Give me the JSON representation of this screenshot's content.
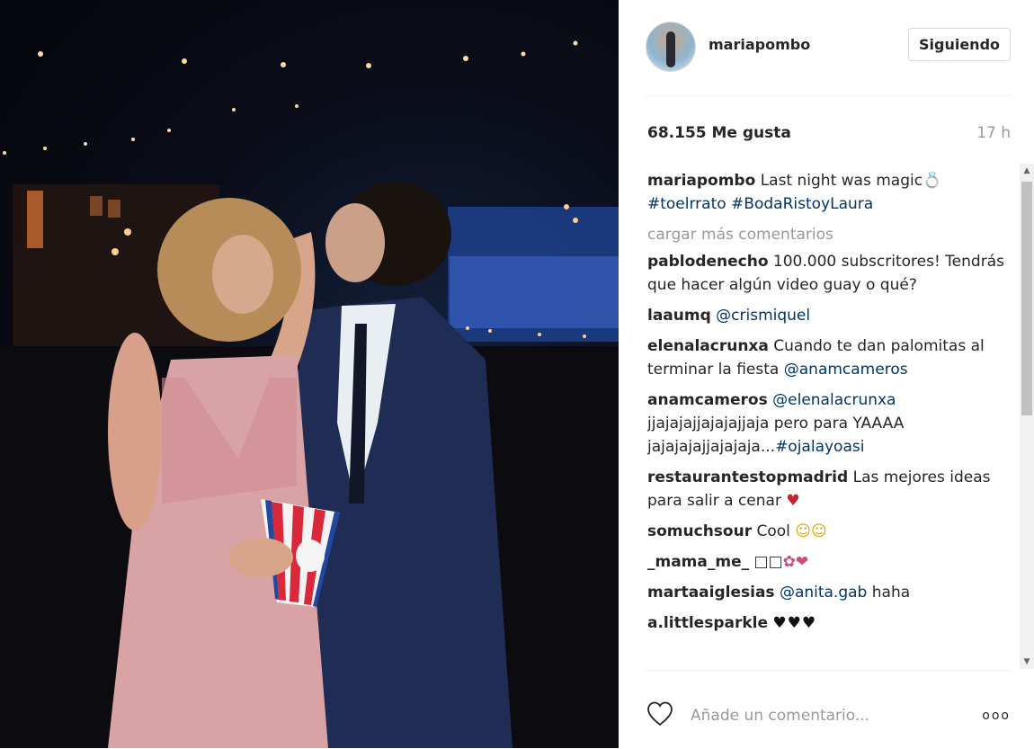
{
  "post": {
    "username": "mariapombo",
    "follow_label": "Siguiendo",
    "likes": "68.155 Me gusta",
    "time": "17 h"
  },
  "caption": {
    "user": "mariapombo",
    "text": "Last night was magic",
    "tags": "#toelrrato #BodaRistoyLaura"
  },
  "load_more": "cargar más comentarios",
  "comments": [
    {
      "user": "pablodenecho",
      "text": "100.000 subscritores! Tendrás que hacer algún video guay o qué?"
    },
    {
      "user": "laaumq",
      "mention": "@crismiquel"
    },
    {
      "user": "elenalacrunxa",
      "text": "Cuando te dan palomitas al terminar la fiesta",
      "mention": "@anamcameros"
    },
    {
      "user": "anamcameros",
      "mention": "@elenalacrunxa",
      "text": "jjajajajjajajajjaja pero para YAAAA jajajajajjajajaja...",
      "tag": "#ojalayoasi"
    },
    {
      "user": "restaurantestopmadrid",
      "text": "Las mejores ideas para salir a cenar"
    },
    {
      "user": "somuchsour",
      "text": "Cool"
    },
    {
      "user": "_mama_me_",
      "text": "□□"
    },
    {
      "user": "martaaiglesias",
      "mention": "@anita.gab",
      "text": "haha"
    },
    {
      "user": "a.littlesparkle",
      "text": ""
    }
  ],
  "footer": {
    "placeholder": "Añade un comentario...",
    "more": "ooo"
  },
  "icons": [
    "heart-outline-icon",
    "more-options-icon",
    "scroll-up-icon",
    "scroll-down-icon"
  ]
}
